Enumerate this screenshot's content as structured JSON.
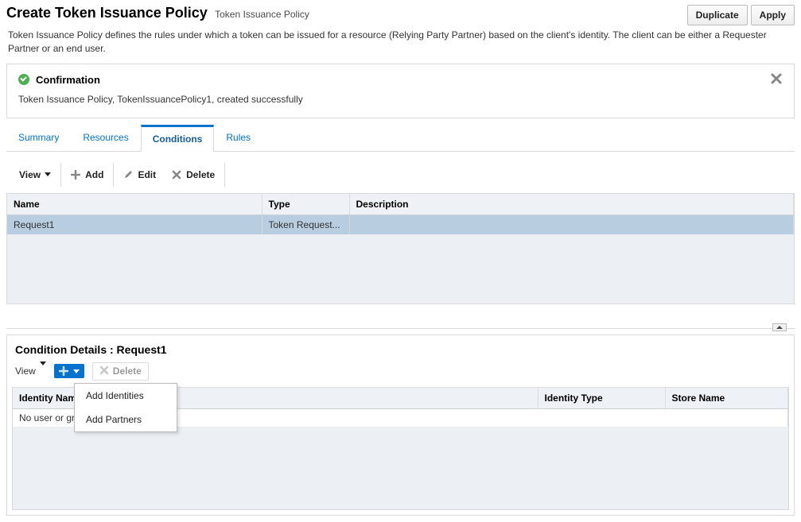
{
  "header": {
    "title": "Create Token Issuance Policy",
    "subtitle": "Token Issuance Policy",
    "duplicate": "Duplicate",
    "apply": "Apply"
  },
  "description": "Token Issuance Policy defines the rules under which a token can be issued for a resource (Relying Party Partner) based on the client's identity. The client can be either a Requester Partner or an end user.",
  "confirmation": {
    "heading": "Confirmation",
    "message": "Token Issuance Policy, TokenIssuancePolicy1, created successfully"
  },
  "tabs": {
    "summary": "Summary",
    "resources": "Resources",
    "conditions": "Conditions",
    "rules": "Rules"
  },
  "conditions_toolbar": {
    "view": "View",
    "add": "Add",
    "edit": "Edit",
    "delete": "Delete"
  },
  "conditions_table": {
    "col_name": "Name",
    "col_type": "Type",
    "col_desc": "Description",
    "row": {
      "name": "Request1",
      "type": "Token Request...",
      "desc": ""
    }
  },
  "details": {
    "title": "Condition Details : Request1",
    "view": "View",
    "delete": "Delete",
    "menu": {
      "add_identities": "Add Identities",
      "add_partners": "Add Partners"
    },
    "table": {
      "col_identity": "Identity Name",
      "col_type": "Identity Type",
      "col_store": "Store Name",
      "empty": "No user or gr"
    }
  }
}
